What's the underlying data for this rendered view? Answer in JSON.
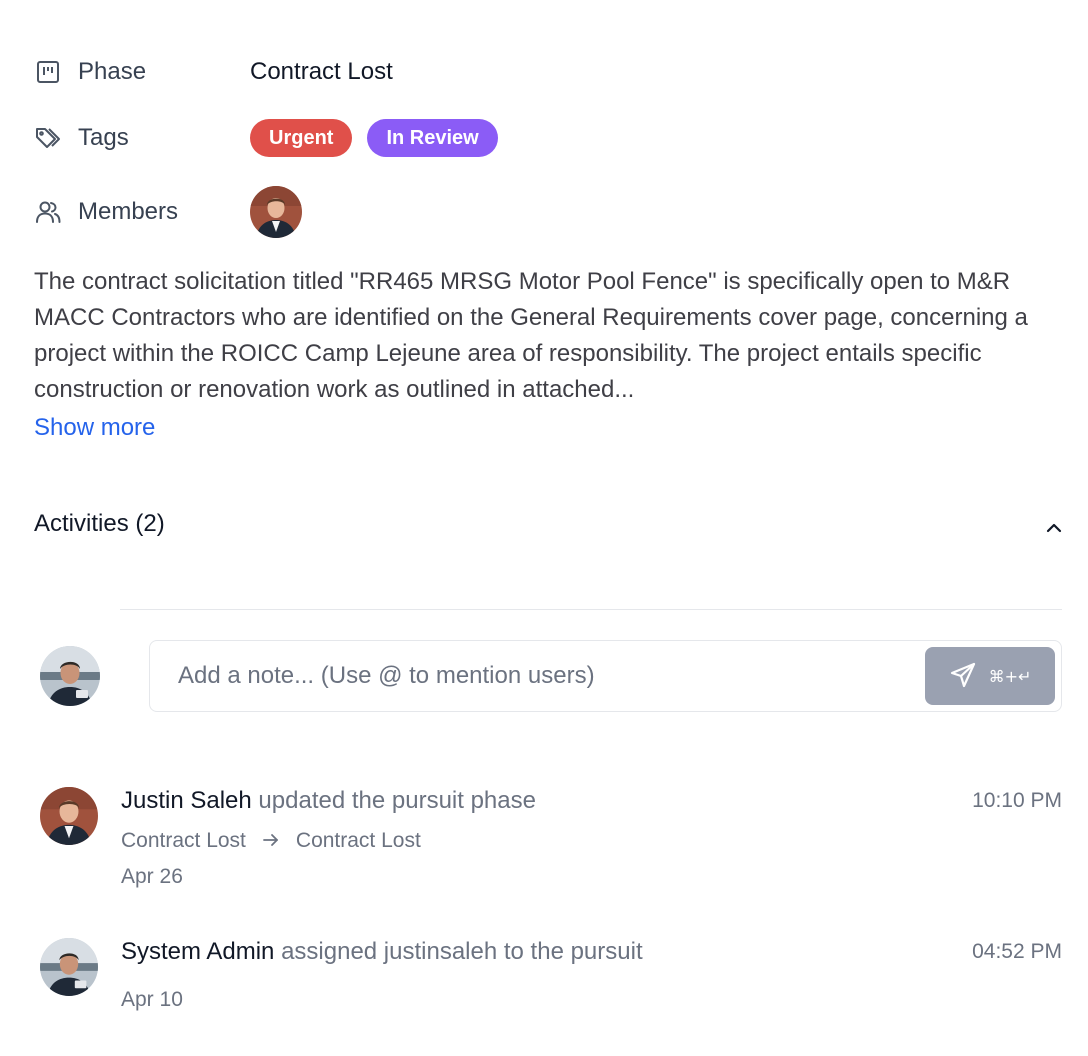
{
  "properties": {
    "phase": {
      "label": "Phase",
      "value": "Contract Lost",
      "icon": "kanban-icon"
    },
    "tags": {
      "label": "Tags",
      "icon": "tag-icon",
      "items": [
        {
          "label": "Urgent",
          "color": "#e0504a"
        },
        {
          "label": "In Review",
          "color": "#8b5cf6"
        }
      ]
    },
    "members": {
      "label": "Members",
      "icon": "users-icon"
    }
  },
  "description": {
    "text": "The contract solicitation titled \"RR465 MRSG Motor Pool Fence\" is specifically open to M&R MACC Contractors who are identified on the General Requirements cover page, concerning a project within the ROICC Camp Lejeune area of responsibility. The project entails specific construction or renovation work as outlined in attached...",
    "show_more": "Show more"
  },
  "activities": {
    "title": "Activities (2)",
    "note_placeholder": "Add a note... (Use @ to mention users)",
    "send_shortcut": "⌘+↵",
    "items": [
      {
        "actor": "Justin Saleh",
        "action": "updated the pursuit phase",
        "time": "10:10 PM",
        "from": "Contract Lost",
        "to": "Contract Lost",
        "date": "Apr 26"
      },
      {
        "actor": "System Admin",
        "action": "assigned justinsaleh to the pursuit",
        "time": "04:52 PM",
        "date": "Apr 10"
      }
    ]
  },
  "colors": {
    "accent": "#2563eb",
    "send_button": "#9aa1b1"
  }
}
